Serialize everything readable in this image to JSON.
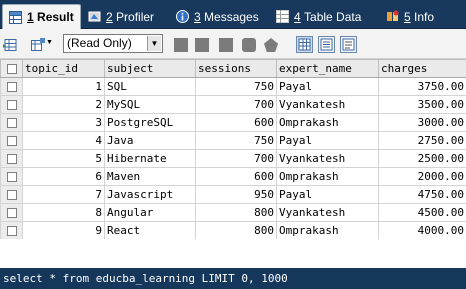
{
  "tabs": [
    {
      "hotkey": "1",
      "label": "Result",
      "icon": "grid-result-icon",
      "active": true
    },
    {
      "hotkey": "2",
      "label": "Profiler",
      "icon": "profiler-icon",
      "active": false
    },
    {
      "hotkey": "3",
      "label": "Messages",
      "icon": "info-icon",
      "active": false
    },
    {
      "hotkey": "4",
      "label": "Table Data",
      "icon": "table-data-icon",
      "active": false
    },
    {
      "hotkey": "5",
      "label": "Info",
      "icon": "info-book-icon",
      "active": false
    }
  ],
  "toolbar": {
    "mode_value": "(Read Only)"
  },
  "grid": {
    "columns": [
      "topic_id",
      "subject",
      "sessions",
      "expert_name",
      "charges"
    ],
    "rows": [
      {
        "topic_id": "1",
        "subject": "SQL",
        "sessions": "750",
        "expert_name": "Payal",
        "charges": "3750.00"
      },
      {
        "topic_id": "2",
        "subject": "MySQL",
        "sessions": "700",
        "expert_name": "Vyankatesh",
        "charges": "3500.00"
      },
      {
        "topic_id": "3",
        "subject": "PostgreSQL",
        "sessions": "600",
        "expert_name": "Omprakash",
        "charges": "3000.00"
      },
      {
        "topic_id": "4",
        "subject": "Java",
        "sessions": "750",
        "expert_name": "Payal",
        "charges": "2750.00"
      },
      {
        "topic_id": "5",
        "subject": "Hibernate",
        "sessions": "700",
        "expert_name": "Vyankatesh",
        "charges": "2500.00"
      },
      {
        "topic_id": "6",
        "subject": "Maven",
        "sessions": "600",
        "expert_name": "Omprakash",
        "charges": "2000.00"
      },
      {
        "topic_id": "7",
        "subject": "Javascript",
        "sessions": "950",
        "expert_name": "Payal",
        "charges": "4750.00"
      },
      {
        "topic_id": "8",
        "subject": "Angular",
        "sessions": "800",
        "expert_name": "Vyankatesh",
        "charges": "4500.00"
      },
      {
        "topic_id": "9",
        "subject": "React",
        "sessions": "800",
        "expert_name": "Omprakash",
        "charges": "4000.00"
      }
    ]
  },
  "status": {
    "query": "select * from educba_learning LIMIT 0, 1000"
  },
  "colors": {
    "tabbar_bg": "#18395d",
    "statusbar_bg": "#15375b"
  }
}
